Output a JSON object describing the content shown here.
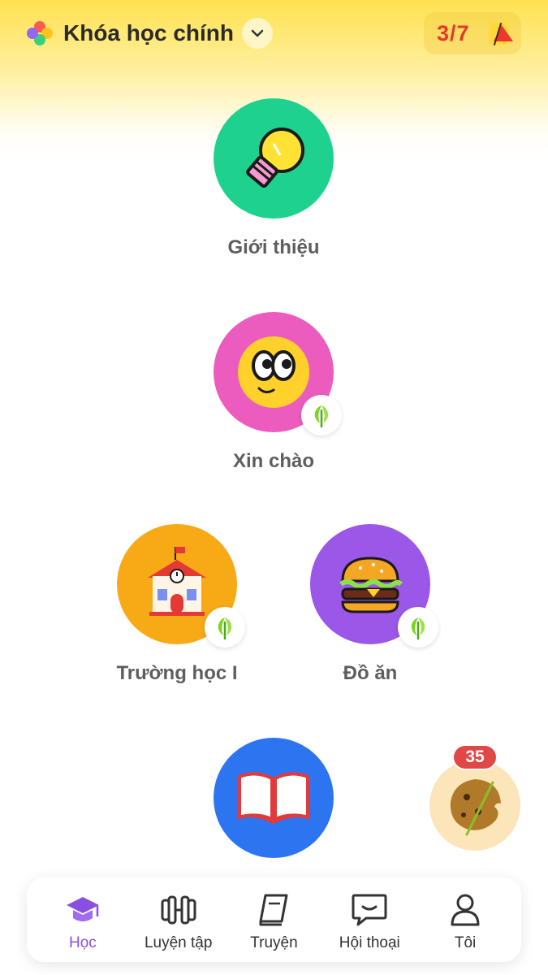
{
  "header": {
    "course_title": "Khóa học chính",
    "progress": "3/7",
    "logo_icon": "petal-logo-icon",
    "dropdown_icon": "chevron-down-icon",
    "progress_icon": "triangle-flag-icon"
  },
  "lessons": [
    {
      "label": "Giới thiệu",
      "icon": "lightbulb-icon",
      "color": "#1fd18f",
      "badge": false
    },
    {
      "label": "Xin chào",
      "icon": "smiley-face-icon",
      "color": "#ec5cbf",
      "badge": true
    },
    {
      "label": "Trường học I",
      "icon": "school-building-icon",
      "color": "#f7a916",
      "badge": true
    },
    {
      "label": "Đồ ăn",
      "icon": "burger-icon",
      "color": "#9b57e8",
      "badge": true
    },
    {
      "label": "",
      "icon": "open-book-icon",
      "color": "#2d74f0",
      "badge": false
    }
  ],
  "cookie": {
    "count": "35",
    "icon": "cookie-icon"
  },
  "nav": [
    {
      "label": "Học",
      "icon": "graduation-cap-icon",
      "active": true
    },
    {
      "label": "Luyện tập",
      "icon": "dumbbell-icon",
      "active": false
    },
    {
      "label": "Truyện",
      "icon": "book-icon",
      "active": false
    },
    {
      "label": "Hội thoại",
      "icon": "chat-bubble-icon",
      "active": false
    },
    {
      "label": "Tôi",
      "icon": "person-icon",
      "active": false
    }
  ],
  "colors": {
    "accent_purple": "#8a4fe0",
    "progress_red": "#e0392e",
    "leaf_green": "#7ed321"
  }
}
